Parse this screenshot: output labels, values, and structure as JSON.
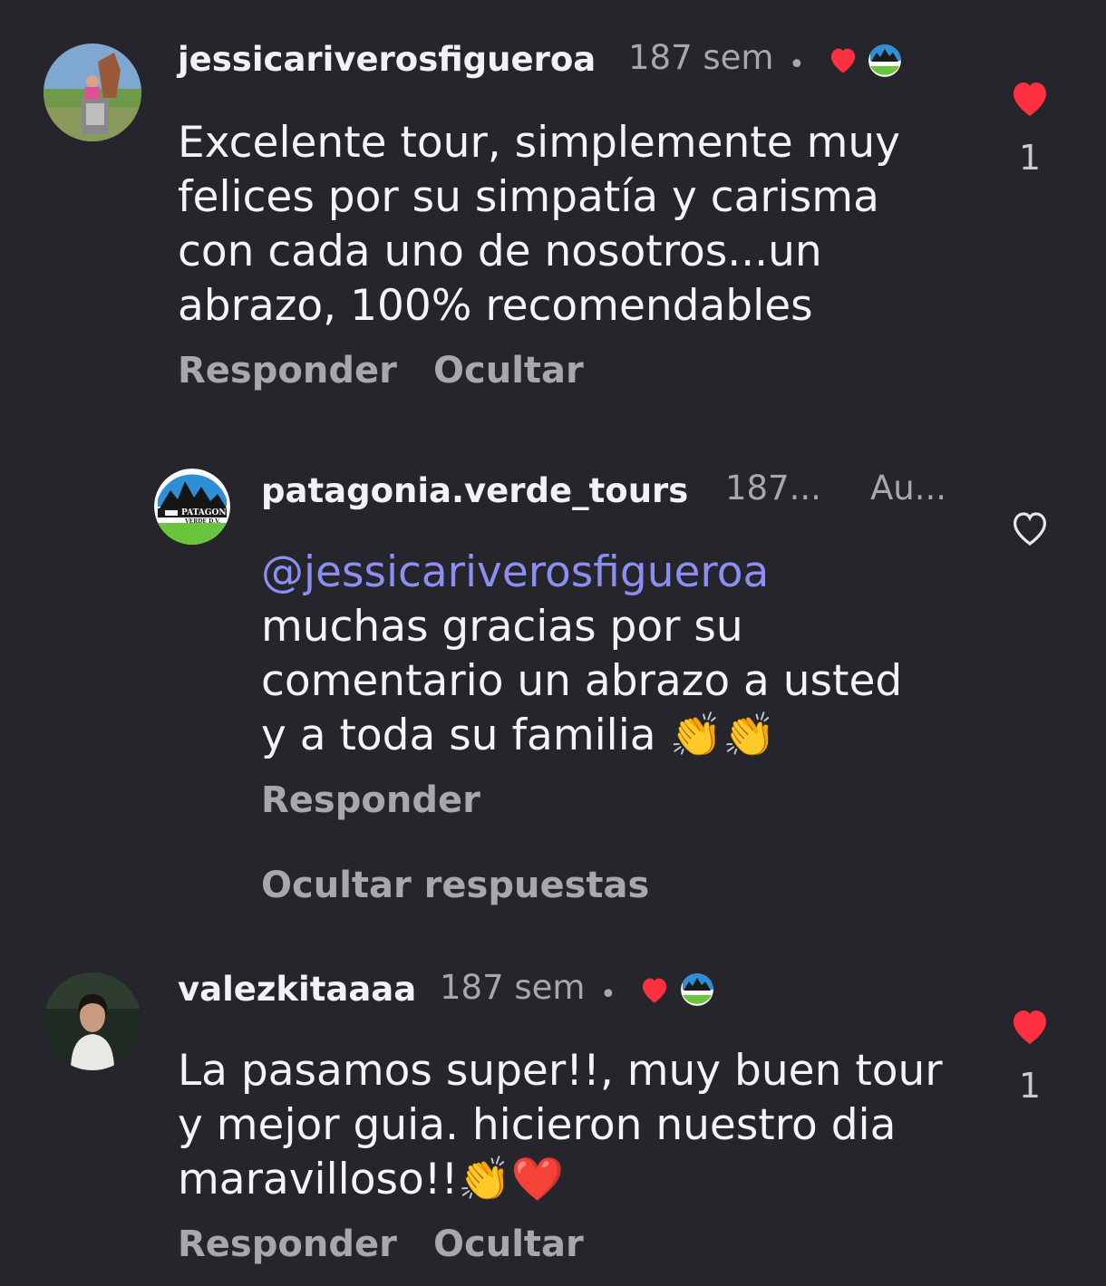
{
  "comments": [
    {
      "username": "jessicariverosfigueroa",
      "time": "187 sem",
      "text": "Excelente tour, simplemente muy felices por su simpatía y carisma con cada uno de nosotros...un abrazo, 100% recomendables",
      "text_lines": [
        "Excelente tour, simplemente muy",
        "felices por su simpatía y carisma",
        "con cada uno de nosotros...un",
        "abrazo, 100% recomendables"
      ],
      "like_count": "1",
      "reply_label": "Responder",
      "hide_label": "Ocultar",
      "liked_by_author": true,
      "avatar_icon": "user-photo-tourist-icon"
    },
    {
      "username": "patagonia.verde_tours",
      "time": "187...",
      "author_badge": "Au...",
      "mention": "@jessicariverosfigueroa",
      "text_lines": [
        "muchas gracias por su",
        "comentario un abrazo a usted",
        "y a toda su familia"
      ],
      "text_emoji": "👏👏",
      "reply_label": "Responder",
      "avatar_icon": "patagonia-verde-logo-icon",
      "logo_text": "PATAGONIA",
      "logo_sub": "VERDE D.V."
    },
    {
      "username": "valezkitaaaa",
      "time": "187 sem",
      "text_lines": [
        "La pasamos super!!, muy buen tour",
        "y mejor guia. hicieron nuestro dia",
        "maravilloso!!"
      ],
      "text_emoji": "👏❤️",
      "like_count": "1",
      "reply_label": "Responder",
      "hide_label": "Ocultar",
      "liked_by_author": true,
      "avatar_icon": "user-photo-woman-icon"
    }
  ],
  "hide_replies_label": "Ocultar respuestas",
  "colors": {
    "background": "#25252b",
    "heart_red": "#ff3040",
    "mention": "#8c8ff2",
    "muted": "#a7a7ad"
  }
}
